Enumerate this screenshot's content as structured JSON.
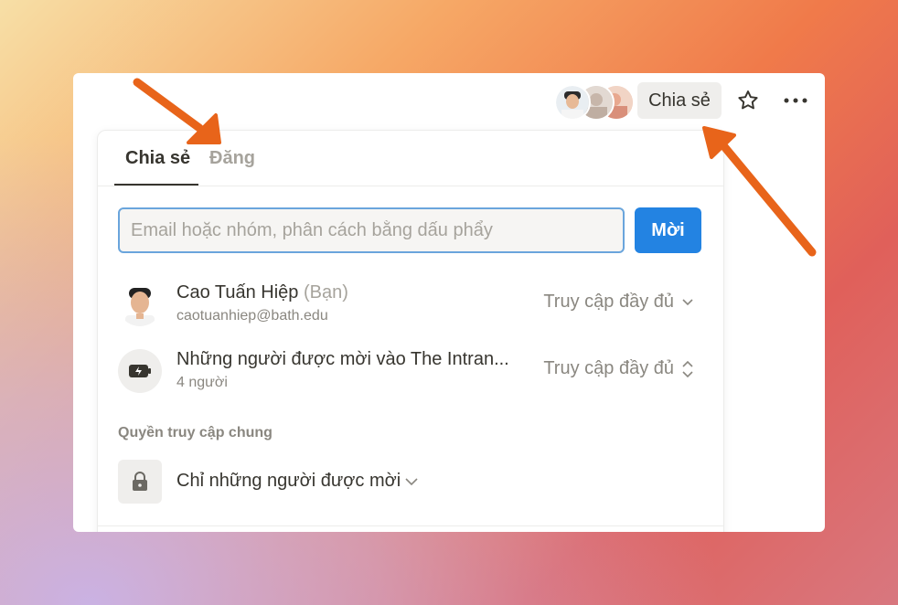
{
  "topbar": {
    "share_label": "Chia sẻ",
    "icons": [
      "avatar-stack",
      "star-icon",
      "more-icon"
    ]
  },
  "tabs": [
    {
      "label": "Chia sẻ",
      "active": true
    },
    {
      "label": "Đăng",
      "active": false
    }
  ],
  "invite": {
    "placeholder": "Email hoặc nhóm, phân cách bằng dấu phẩy",
    "button_label": "Mời"
  },
  "members": [
    {
      "name": "Cao Tuấn Hiệp",
      "tag": "(Bạn)",
      "email": "caotuanhiep@bath.edu",
      "access": "Truy cập đầy đủ"
    },
    {
      "name": "Những người được mời vào The Intran...",
      "sub": "4 người",
      "access": "Truy cập đầy đủ"
    }
  ],
  "general": {
    "section_label": "Quyền truy cập chung",
    "access_label": "Chỉ những người được mời"
  },
  "colors": {
    "accent": "#2383e2",
    "arrow": "#e8641a",
    "text": "#37352f",
    "muted": "#8a8780"
  }
}
